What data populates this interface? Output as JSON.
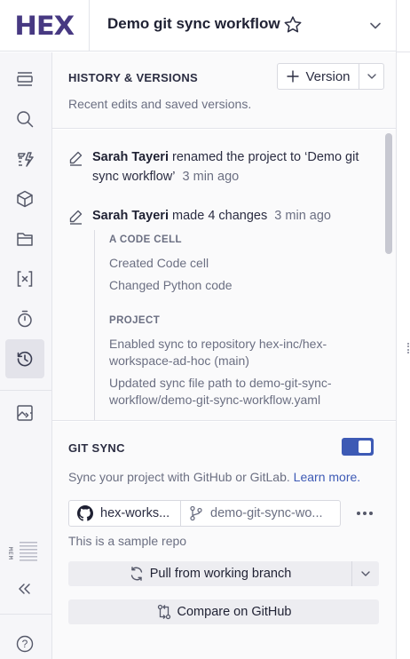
{
  "app": {
    "logo_text": "HEX",
    "project_title": "Demo git sync workflow"
  },
  "rail": {
    "items": [
      {
        "name": "outline",
        "icon": "layers-icon"
      },
      {
        "name": "search",
        "icon": "search-icon"
      },
      {
        "name": "data-sources",
        "icon": "data-bolt-icon"
      },
      {
        "name": "components",
        "icon": "cube-icon"
      },
      {
        "name": "files",
        "icon": "folder-icon"
      },
      {
        "name": "variables",
        "icon": "variables-icon"
      },
      {
        "name": "schedules",
        "icon": "timer-icon"
      },
      {
        "name": "history",
        "icon": "history-icon",
        "active": true
      },
      {
        "name": "environment",
        "icon": "image-code-icon"
      }
    ],
    "bottom": {
      "mem_label": "MEM",
      "collapse_icon": "double-chevron-left-icon",
      "help_glyph": "?"
    }
  },
  "history": {
    "title": "HISTORY & VERSIONS",
    "version_button": "Version",
    "subtitle": "Recent edits and saved versions.",
    "entries": [
      {
        "user": "Sarah Tayeri",
        "action": " renamed the project to ‘Demo git sync workflow’",
        "time": "3 min ago"
      },
      {
        "user": "Sarah Tayeri",
        "action": " made 4 changes",
        "time": "3 min ago"
      }
    ],
    "change_groups": [
      {
        "title": "A CODE CELL",
        "items": [
          "Created Code cell",
          "Changed Python code"
        ]
      },
      {
        "title": "PROJECT",
        "items": [
          "Enabled sync to repository hex-inc/hex-workspace-ad-hoc (main)",
          "Updated sync file path to demo-git-sync-workflow/demo-git-sync-workflow.yaml"
        ]
      }
    ]
  },
  "git_sync": {
    "title": "GIT SYNC",
    "enabled": true,
    "description": "Sync your project with GitHub or GitLab.",
    "learn_more": "Learn more.",
    "repo": "hex-works...",
    "branch_path": "demo-git-sync-wo...",
    "note": "This is a sample repo",
    "pull_button": "Pull from working branch",
    "compare_button": "Compare on GitHub"
  },
  "colors": {
    "brand": "#473982",
    "accent": "#3d5ab5",
    "rail_bg": "#f6f6f9",
    "active_rail": "#e3e3ea"
  }
}
